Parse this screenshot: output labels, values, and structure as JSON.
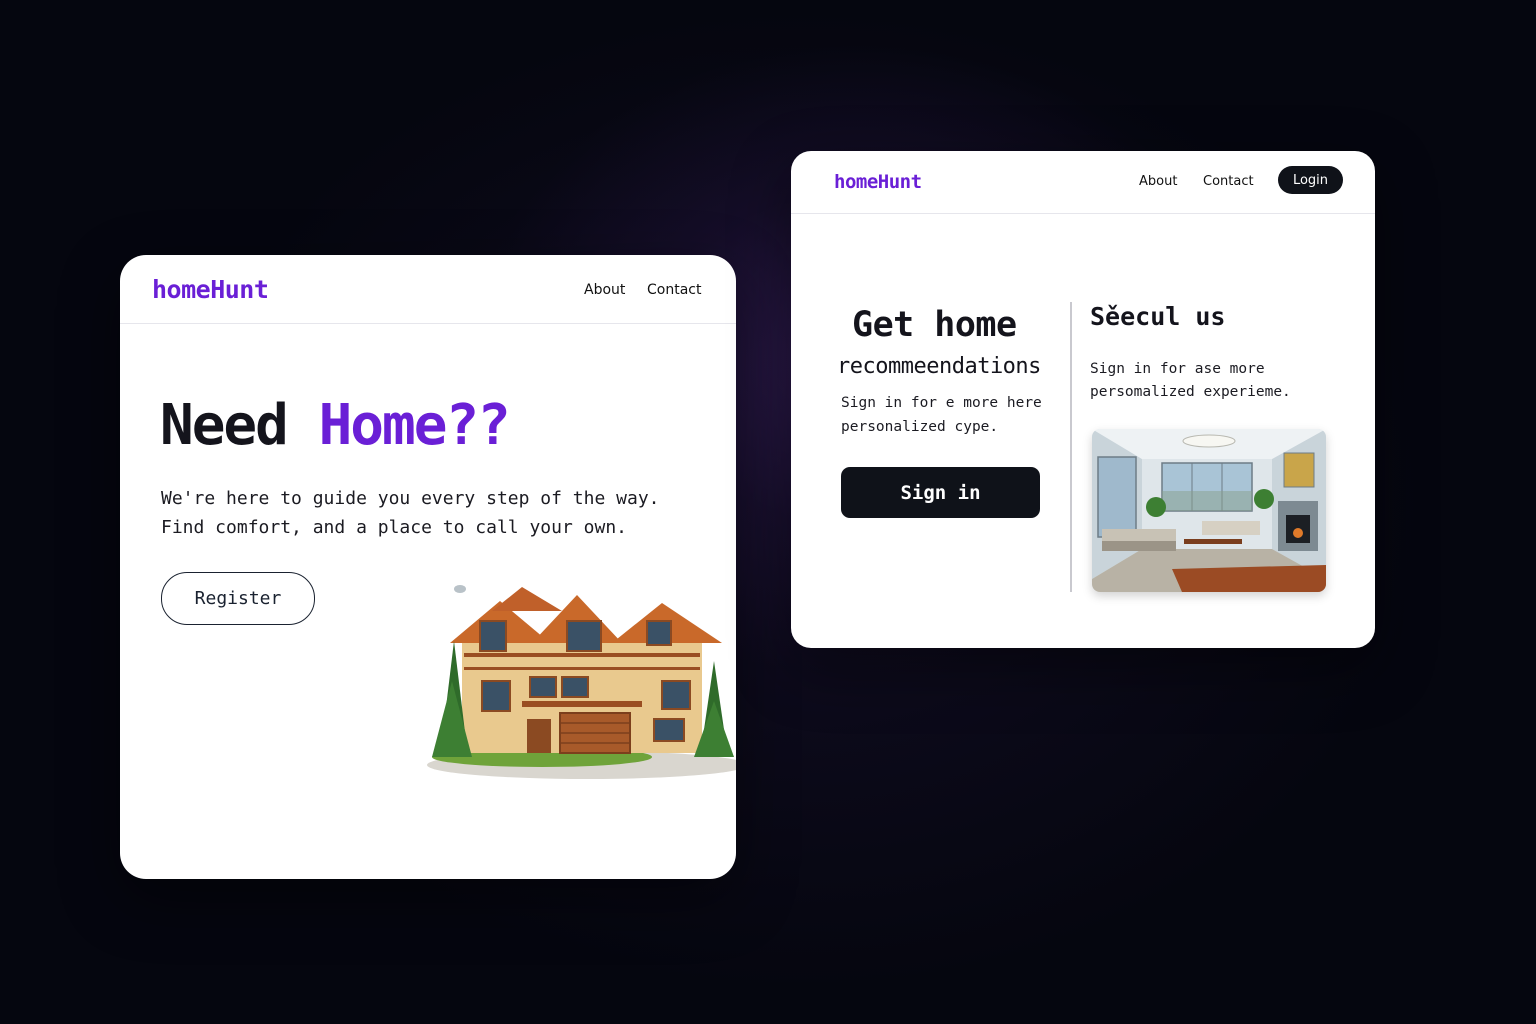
{
  "left_card": {
    "brand": "homeHunt",
    "nav": {
      "about": "About",
      "contact": "Contact"
    },
    "hero": {
      "title_part1": "Need ",
      "title_part2": "Home??",
      "subtitle_line1": "We're here to guide you every step of the way.",
      "subtitle_line2": "Find comfort, and a place to call your own."
    },
    "register_label": "Register"
  },
  "right_card": {
    "brand": "homeHunt",
    "nav": {
      "about": "About",
      "contact": "Contact",
      "login": "Login"
    },
    "left_panel": {
      "title_line1": "Get home",
      "title_line2": "recommeendations",
      "sub_line1": "Sign in for e more here",
      "sub_line2": "personalized cype.",
      "signin_label": "Sign in"
    },
    "right_panel": {
      "title": "Sěecul us",
      "sub_line1": "Sign in for ase more",
      "sub_line2": "persomalized experieme."
    }
  },
  "colors": {
    "accent": "#6a1fd6",
    "dark_button": "#0f1219",
    "background": "#05060f"
  }
}
